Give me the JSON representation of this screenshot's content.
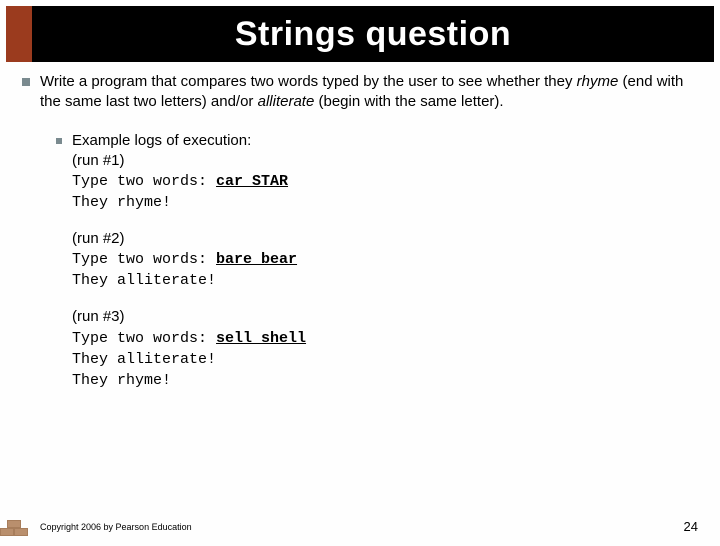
{
  "title": "Strings question",
  "intro": {
    "pre": "Write a program that compares two words typed by the user to see whether they ",
    "italic1": "rhyme",
    "mid": " (end with the same last two letters) and/or ",
    "italic2": "alliterate",
    "post": " (begin with the same letter)."
  },
  "example": {
    "heading": "Example logs of execution:",
    "run1": {
      "label": "(run #1)",
      "prompt": "Type two words: ",
      "input": "car STAR",
      "out1": "They rhyme!"
    },
    "run2": {
      "label": "(run #2)",
      "prompt": "Type two words: ",
      "input": "bare bear",
      "out1": "They alliterate!"
    },
    "run3": {
      "label": "(run #3)",
      "prompt": "Type two words: ",
      "input": "sell shell",
      "out1": "They alliterate!",
      "out2": "They rhyme!"
    }
  },
  "footer": "Copyright 2006 by Pearson Education",
  "page": "24"
}
